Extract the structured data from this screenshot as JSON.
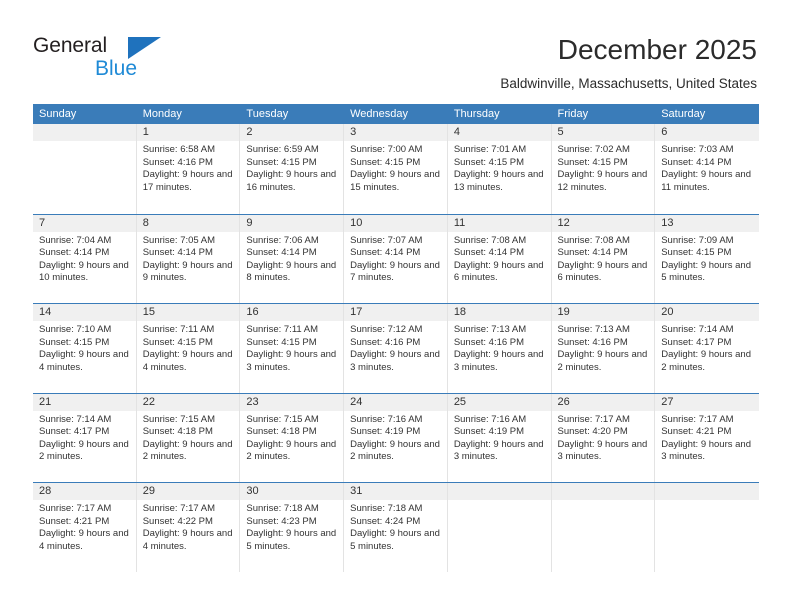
{
  "brand": {
    "name_dark": "General",
    "name_blue": "Blue",
    "accent_blue": "#1f8ad6",
    "triangle_blue": "#1f72bd"
  },
  "header": {
    "title": "December 2025",
    "subtitle": "Baldwinville, Massachusetts, United States"
  },
  "calendar": {
    "header_bg": "#3a7cb9",
    "daynum_bg": "#f0f0f0",
    "weekdays": [
      "Sunday",
      "Monday",
      "Tuesday",
      "Wednesday",
      "Thursday",
      "Friday",
      "Saturday"
    ],
    "weeks": [
      [
        {
          "day": "",
          "empty": true
        },
        {
          "day": "1",
          "sunrise": "Sunrise: 6:58 AM",
          "sunset": "Sunset: 4:16 PM",
          "daylight": "Daylight: 9 hours and 17 minutes."
        },
        {
          "day": "2",
          "sunrise": "Sunrise: 6:59 AM",
          "sunset": "Sunset: 4:15 PM",
          "daylight": "Daylight: 9 hours and 16 minutes."
        },
        {
          "day": "3",
          "sunrise": "Sunrise: 7:00 AM",
          "sunset": "Sunset: 4:15 PM",
          "daylight": "Daylight: 9 hours and 15 minutes."
        },
        {
          "day": "4",
          "sunrise": "Sunrise: 7:01 AM",
          "sunset": "Sunset: 4:15 PM",
          "daylight": "Daylight: 9 hours and 13 minutes."
        },
        {
          "day": "5",
          "sunrise": "Sunrise: 7:02 AM",
          "sunset": "Sunset: 4:15 PM",
          "daylight": "Daylight: 9 hours and 12 minutes."
        },
        {
          "day": "6",
          "sunrise": "Sunrise: 7:03 AM",
          "sunset": "Sunset: 4:14 PM",
          "daylight": "Daylight: 9 hours and 11 minutes."
        }
      ],
      [
        {
          "day": "7",
          "sunrise": "Sunrise: 7:04 AM",
          "sunset": "Sunset: 4:14 PM",
          "daylight": "Daylight: 9 hours and 10 minutes."
        },
        {
          "day": "8",
          "sunrise": "Sunrise: 7:05 AM",
          "sunset": "Sunset: 4:14 PM",
          "daylight": "Daylight: 9 hours and 9 minutes."
        },
        {
          "day": "9",
          "sunrise": "Sunrise: 7:06 AM",
          "sunset": "Sunset: 4:14 PM",
          "daylight": "Daylight: 9 hours and 8 minutes."
        },
        {
          "day": "10",
          "sunrise": "Sunrise: 7:07 AM",
          "sunset": "Sunset: 4:14 PM",
          "daylight": "Daylight: 9 hours and 7 minutes."
        },
        {
          "day": "11",
          "sunrise": "Sunrise: 7:08 AM",
          "sunset": "Sunset: 4:14 PM",
          "daylight": "Daylight: 9 hours and 6 minutes."
        },
        {
          "day": "12",
          "sunrise": "Sunrise: 7:08 AM",
          "sunset": "Sunset: 4:14 PM",
          "daylight": "Daylight: 9 hours and 6 minutes."
        },
        {
          "day": "13",
          "sunrise": "Sunrise: 7:09 AM",
          "sunset": "Sunset: 4:15 PM",
          "daylight": "Daylight: 9 hours and 5 minutes."
        }
      ],
      [
        {
          "day": "14",
          "sunrise": "Sunrise: 7:10 AM",
          "sunset": "Sunset: 4:15 PM",
          "daylight": "Daylight: 9 hours and 4 minutes."
        },
        {
          "day": "15",
          "sunrise": "Sunrise: 7:11 AM",
          "sunset": "Sunset: 4:15 PM",
          "daylight": "Daylight: 9 hours and 4 minutes."
        },
        {
          "day": "16",
          "sunrise": "Sunrise: 7:11 AM",
          "sunset": "Sunset: 4:15 PM",
          "daylight": "Daylight: 9 hours and 3 minutes."
        },
        {
          "day": "17",
          "sunrise": "Sunrise: 7:12 AM",
          "sunset": "Sunset: 4:16 PM",
          "daylight": "Daylight: 9 hours and 3 minutes."
        },
        {
          "day": "18",
          "sunrise": "Sunrise: 7:13 AM",
          "sunset": "Sunset: 4:16 PM",
          "daylight": "Daylight: 9 hours and 3 minutes."
        },
        {
          "day": "19",
          "sunrise": "Sunrise: 7:13 AM",
          "sunset": "Sunset: 4:16 PM",
          "daylight": "Daylight: 9 hours and 2 minutes."
        },
        {
          "day": "20",
          "sunrise": "Sunrise: 7:14 AM",
          "sunset": "Sunset: 4:17 PM",
          "daylight": "Daylight: 9 hours and 2 minutes."
        }
      ],
      [
        {
          "day": "21",
          "sunrise": "Sunrise: 7:14 AM",
          "sunset": "Sunset: 4:17 PM",
          "daylight": "Daylight: 9 hours and 2 minutes."
        },
        {
          "day": "22",
          "sunrise": "Sunrise: 7:15 AM",
          "sunset": "Sunset: 4:18 PM",
          "daylight": "Daylight: 9 hours and 2 minutes."
        },
        {
          "day": "23",
          "sunrise": "Sunrise: 7:15 AM",
          "sunset": "Sunset: 4:18 PM",
          "daylight": "Daylight: 9 hours and 2 minutes."
        },
        {
          "day": "24",
          "sunrise": "Sunrise: 7:16 AM",
          "sunset": "Sunset: 4:19 PM",
          "daylight": "Daylight: 9 hours and 2 minutes."
        },
        {
          "day": "25",
          "sunrise": "Sunrise: 7:16 AM",
          "sunset": "Sunset: 4:19 PM",
          "daylight": "Daylight: 9 hours and 3 minutes."
        },
        {
          "day": "26",
          "sunrise": "Sunrise: 7:17 AM",
          "sunset": "Sunset: 4:20 PM",
          "daylight": "Daylight: 9 hours and 3 minutes."
        },
        {
          "day": "27",
          "sunrise": "Sunrise: 7:17 AM",
          "sunset": "Sunset: 4:21 PM",
          "daylight": "Daylight: 9 hours and 3 minutes."
        }
      ],
      [
        {
          "day": "28",
          "sunrise": "Sunrise: 7:17 AM",
          "sunset": "Sunset: 4:21 PM",
          "daylight": "Daylight: 9 hours and 4 minutes."
        },
        {
          "day": "29",
          "sunrise": "Sunrise: 7:17 AM",
          "sunset": "Sunset: 4:22 PM",
          "daylight": "Daylight: 9 hours and 4 minutes."
        },
        {
          "day": "30",
          "sunrise": "Sunrise: 7:18 AM",
          "sunset": "Sunset: 4:23 PM",
          "daylight": "Daylight: 9 hours and 5 minutes."
        },
        {
          "day": "31",
          "sunrise": "Sunrise: 7:18 AM",
          "sunset": "Sunset: 4:24 PM",
          "daylight": "Daylight: 9 hours and 5 minutes."
        },
        {
          "day": "",
          "empty": true
        },
        {
          "day": "",
          "empty": true
        },
        {
          "day": "",
          "empty": true
        }
      ]
    ]
  }
}
